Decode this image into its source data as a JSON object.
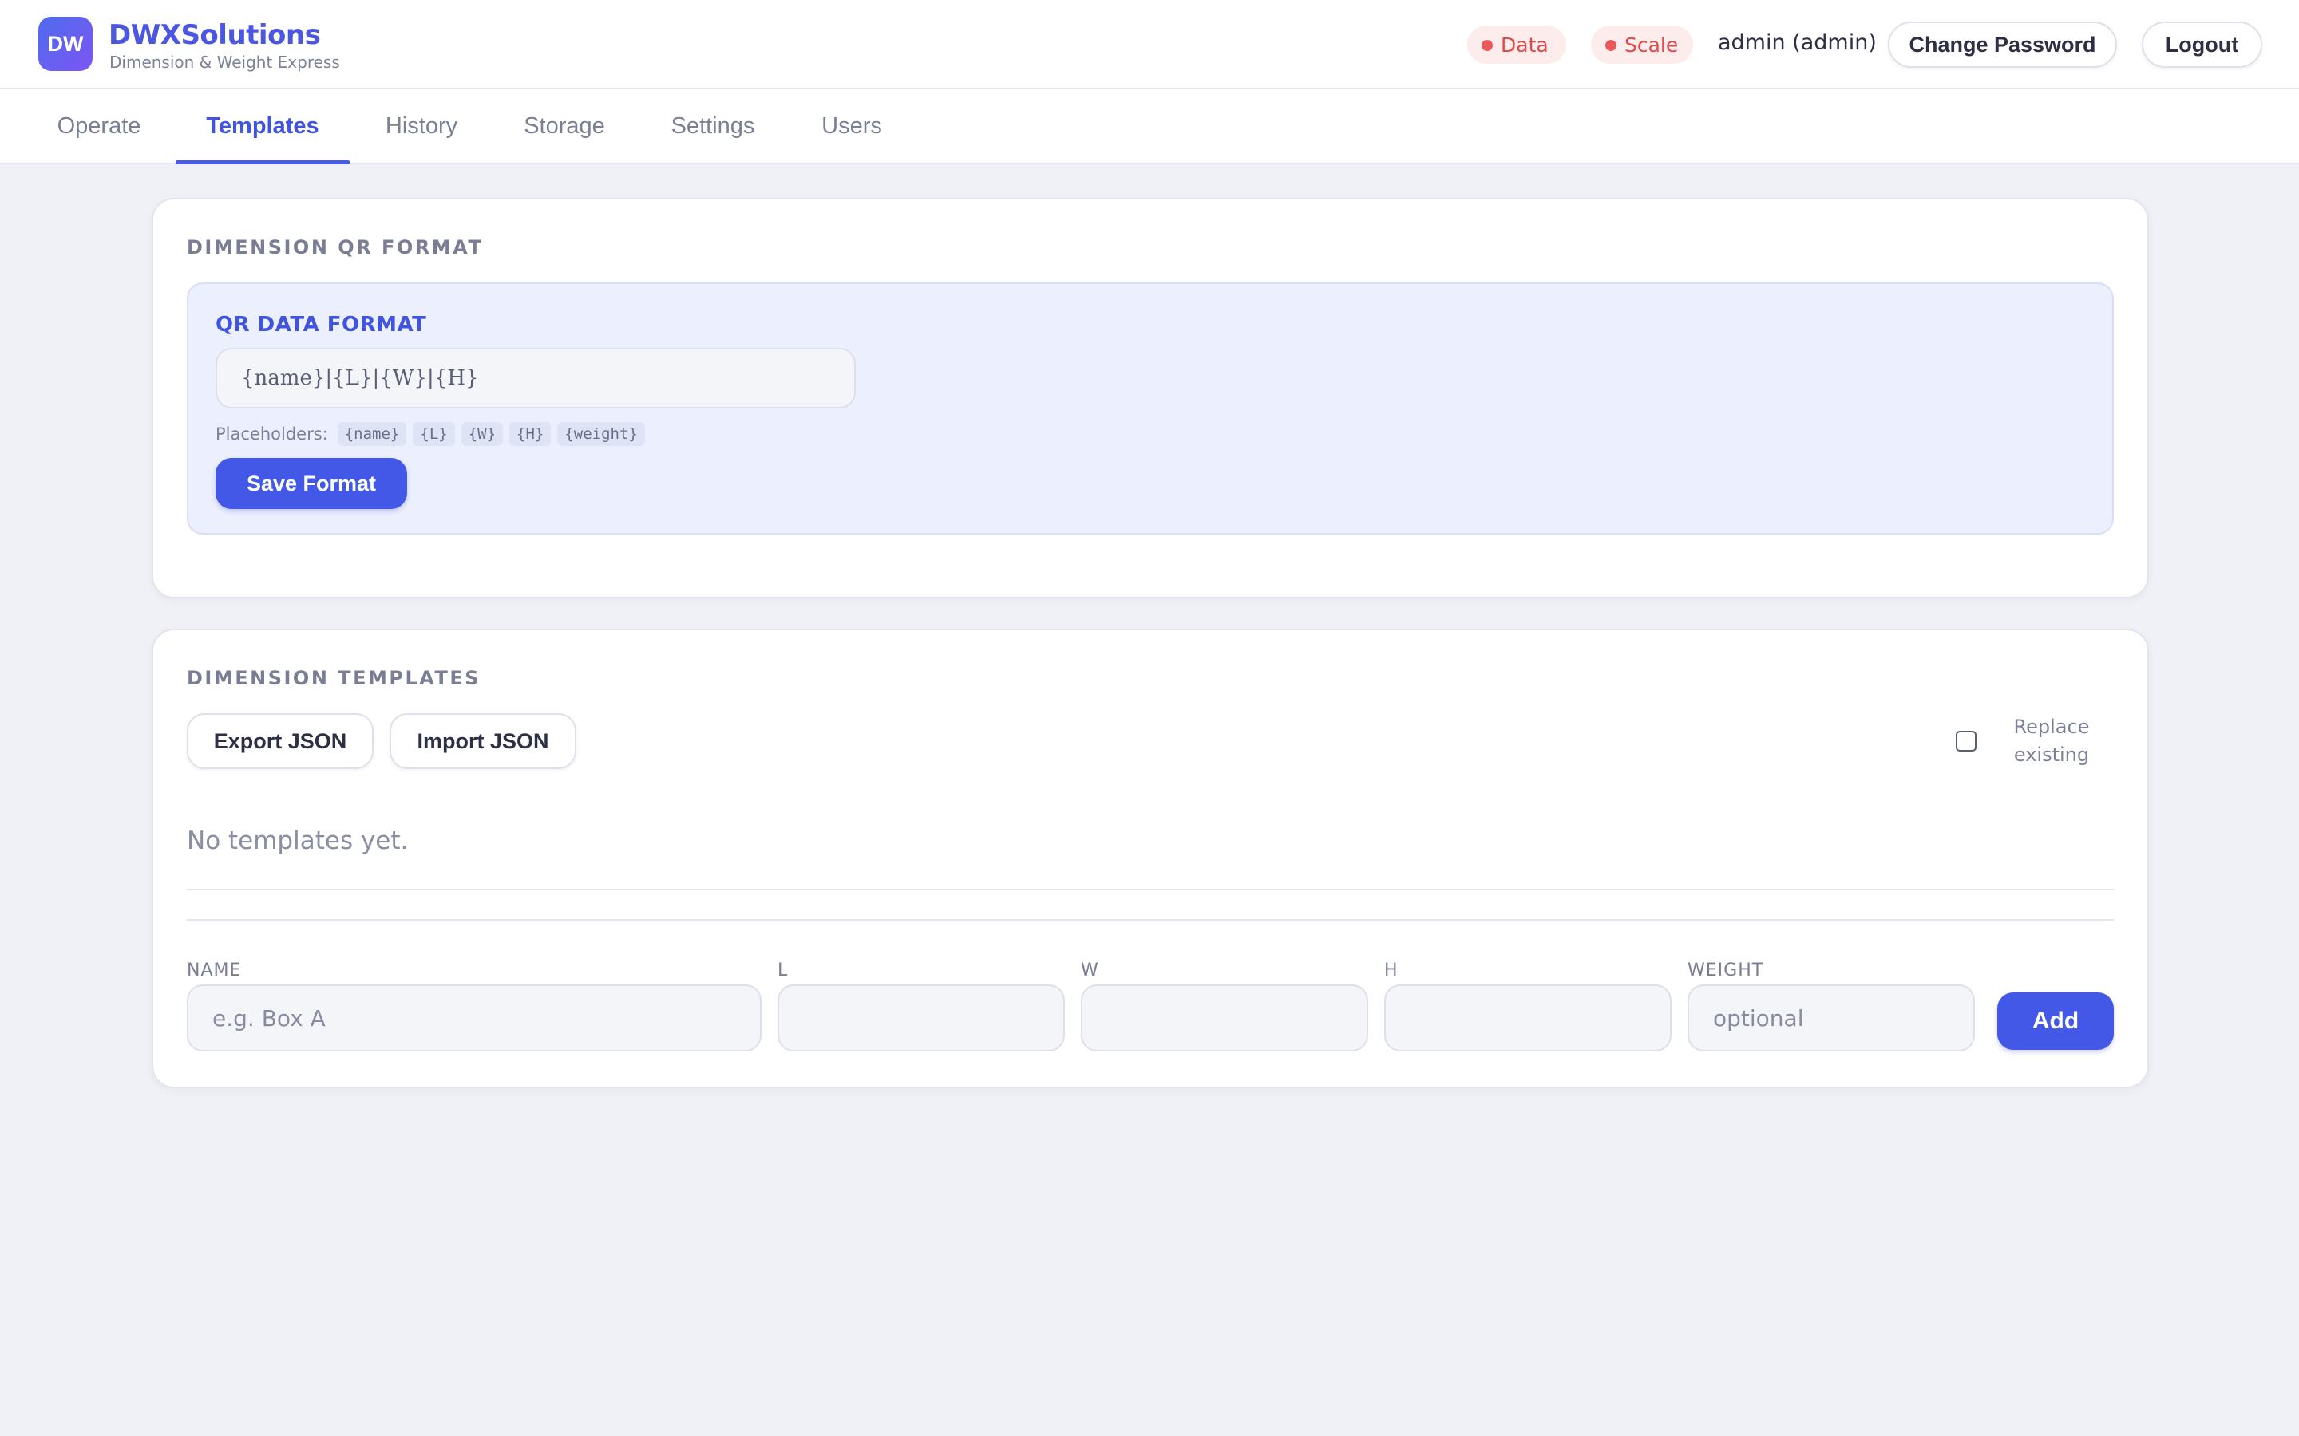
{
  "brand": {
    "logo_text": "DW",
    "name": "DWXSolutions",
    "subtitle": "Dimension & Weight Express"
  },
  "status": {
    "data_label": "Data",
    "scale_label": "Scale",
    "color": "#e04a4a"
  },
  "user": {
    "label": "admin (admin)",
    "change_password": "Change Password",
    "logout": "Logout"
  },
  "tabs": [
    {
      "label": "Operate",
      "active": false
    },
    {
      "label": "Templates",
      "active": true
    },
    {
      "label": "History",
      "active": false
    },
    {
      "label": "Storage",
      "active": false
    },
    {
      "label": "Settings",
      "active": false
    },
    {
      "label": "Users",
      "active": false
    }
  ],
  "qr_format": {
    "section_title": "DIMENSION QR FORMAT",
    "panel_title": "QR DATA FORMAT",
    "value": "{name}|{L}|{W}|{H}",
    "placeholders_label": "Placeholders:",
    "placeholders": [
      "{name}",
      "{L}",
      "{W}",
      "{H}",
      "{weight}"
    ],
    "save_label": "Save Format"
  },
  "templates": {
    "section_title": "DIMENSION TEMPLATES",
    "export_label": "Export JSON",
    "import_label": "Import JSON",
    "replace_label": "Replace existing",
    "replace_checked": false,
    "empty_text": "No templates yet.",
    "form": {
      "name_label": "NAME",
      "name_placeholder": "e.g. Box A",
      "l_label": "L",
      "w_label": "W",
      "h_label": "H",
      "weight_label": "WEIGHT",
      "weight_placeholder": "optional",
      "add_label": "Add"
    }
  },
  "colors": {
    "accent": "#4358e6",
    "background": "#f0f1f6",
    "panel": "#eceffd"
  }
}
